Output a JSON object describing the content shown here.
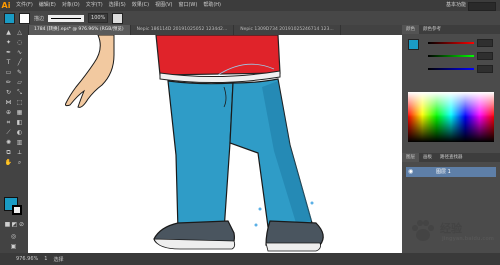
{
  "app": {
    "logo": "Ai"
  },
  "menubar": {
    "items": [
      "文件(F)",
      "编辑(E)",
      "对象(O)",
      "文字(T)",
      "选择(S)",
      "效果(C)",
      "视图(V)",
      "窗口(W)",
      "帮助(H)"
    ],
    "workspace": "基本功能"
  },
  "control": {
    "fill_color": "#1a9bc4",
    "stroke_color": "#ffffff",
    "opacity": "100%",
    "style_label": "描边"
  },
  "tabs": [
    {
      "label": "1784 [转换].eps* @ 976.96% (RGB/预览)",
      "active": true
    },
    {
      "label": "Nepic 186114D 20191025052 1234d2...",
      "active": false
    },
    {
      "label": "Nepic 1309D734 20191025246714 123...",
      "active": false
    }
  ],
  "panel": {
    "tabs": [
      "颜色",
      "颜色参考"
    ],
    "layer_tabs": [
      "图层",
      "画板",
      "路径查找器"
    ],
    "layer_name": "图层 1",
    "slider_values": [
      "",
      "",
      ""
    ]
  },
  "status": {
    "zoom": "976.96%",
    "page": "1",
    "mode": "选择"
  },
  "colors": {
    "shirt": "#e0232a",
    "jeans": "#2f9cc7",
    "jeans_shadow": "#1f7fa8",
    "shoe": "#4a555f",
    "skin": "#f2c9a0",
    "accent": "#1a9bc4"
  },
  "watermark": {
    "text": "经验",
    "url": "jingyan.baidu.com"
  }
}
